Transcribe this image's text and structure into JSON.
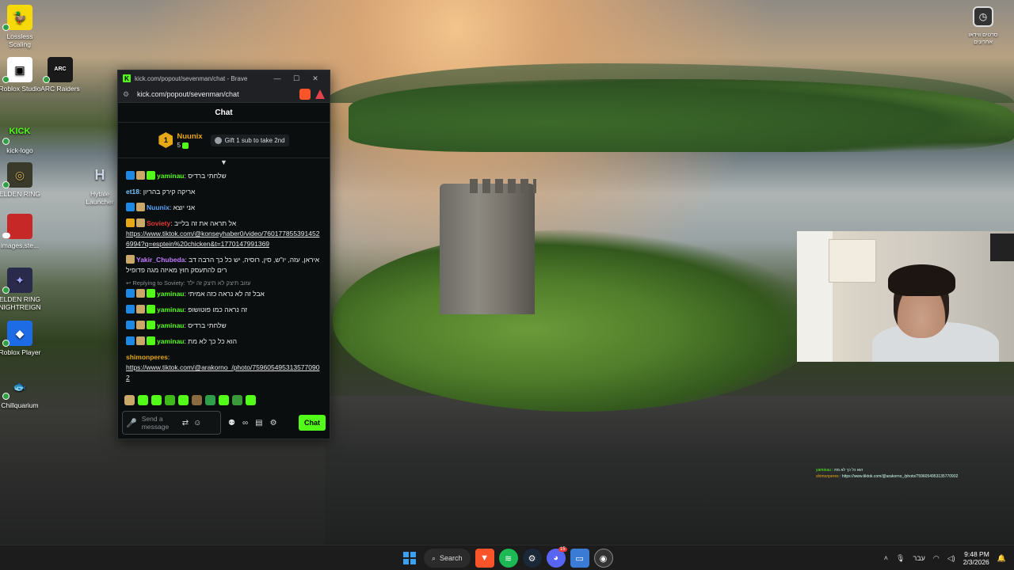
{
  "desktop": {
    "icons": [
      {
        "label": "Lossless Scaling",
        "icon": "duck-icon",
        "color": "#f5d90a",
        "status": "synced"
      },
      {
        "label": "Roblox Studio",
        "icon": "roblox-studio-icon",
        "color": "#ffffff",
        "status": "synced"
      },
      {
        "label": "ARC Raiders",
        "icon": "arc-raiders-icon",
        "color": "#1a1a1a",
        "status": "synced"
      },
      {
        "label": "kick-logo",
        "icon": "kick-logo-icon",
        "color": "#53fc18",
        "status": "synced"
      },
      {
        "label": "ELDEN RING",
        "icon": "elden-ring-icon",
        "color": "#3a3a2a",
        "status": "synced"
      },
      {
        "label": "Hytale Launcher",
        "icon": "hytale-icon",
        "color": "#8fa5c0",
        "status": "none"
      },
      {
        "label": "images.ste...",
        "icon": "image-file-icon",
        "color": "#c62828",
        "status": "cloud"
      },
      {
        "label": "ELDEN RING NIGHTREIGN",
        "icon": "nightreign-icon",
        "color": "#2a2a4a",
        "status": "synced"
      },
      {
        "label": "Roblox Player",
        "icon": "roblox-player-icon",
        "color": "#1e6be6",
        "status": "synced"
      },
      {
        "label": "Chillquarium",
        "icon": "fish-icon",
        "color": "#4a90c0",
        "status": "synced"
      }
    ],
    "top_right": {
      "label": "סרטים ווידאו",
      "sublabel": "אחרונים"
    }
  },
  "browser": {
    "window_title": "kick.com/popout/sevenman/chat - Brave",
    "url": "kick.com/popout/sevenman/chat",
    "rewards_badge": "1"
  },
  "chat": {
    "header": "Chat",
    "pinned": {
      "rank": "1",
      "user": "Nuunix",
      "count": "5",
      "gift_label": "Gift 1 sub to take 2nd"
    },
    "messages": [
      {
        "badges": [
          "verified",
          "sub",
          "green"
        ],
        "user": "yaminau",
        "user_color": "#53fc18",
        "text": "שלחתי ברדיס"
      },
      {
        "badges": [],
        "user": "et18",
        "user_color": "#79c5ff",
        "text": "אריקה קירק בהריון"
      },
      {
        "badges": [
          "verified",
          "sub"
        ],
        "user": "Nuunix",
        "user_color": "#5aa6ff",
        "text": "אני יוצא"
      },
      {
        "badges": [
          "gold",
          "sub"
        ],
        "user": "Soviety",
        "user_color": "#e53935",
        "text": "אל תראה את זה בלייב",
        "link": "https://www.tiktok.com/@konseyhaber0/video/7601778553914526994?q=esptein%20chicken&t=1770147991369"
      },
      {
        "badges": [
          "sub"
        ],
        "user": "Yakir_Chubeda",
        "user_color": "#c27bff",
        "text": "איראן, עזה, יו\"ש, סין, רוסיה, יש כל כך הרבה דברים להתעסק חוץ מאיזה מגה פדופיל"
      },
      {
        "badges": [
          "verified",
          "sub",
          "green"
        ],
        "user": "yaminau",
        "user_color": "#53fc18",
        "text": "אבל זה לא נראה כזה אמיתי",
        "reply_to": "Replying to Soviety:",
        "reply_text": "עזוב תיצק לא תיצק זה ילד"
      },
      {
        "badges": [
          "verified",
          "sub",
          "green"
        ],
        "user": "yaminau",
        "user_color": "#53fc18",
        "text": "זה נראה כמו פוטושופ"
      },
      {
        "badges": [
          "verified",
          "sub",
          "green"
        ],
        "user": "yaminau",
        "user_color": "#53fc18",
        "text": "שלחתי ברדיס"
      },
      {
        "badges": [
          "verified",
          "sub",
          "green"
        ],
        "user": "yaminau",
        "user_color": "#53fc18",
        "text": "הוא כל כך לא מת"
      },
      {
        "badges": [],
        "user": "shimonperes",
        "user_color": "#e6a817",
        "text": "",
        "link": "https://www.tiktok.com/@arakorno_/photo/7596054953135770902"
      }
    ],
    "composer": {
      "placeholder": "Send a message",
      "send_label": "Chat"
    }
  },
  "stream_overlay": {
    "line1_user": "yaminau",
    "line1_text": "הוא כל כך לא מת",
    "line2_user": "shimonperes",
    "line2_text": "https://www.tiktok.com/@arakorno_/photo/7596054953135770902"
  },
  "taskbar": {
    "search_label": "Search",
    "discord_badge": "15",
    "language": "עבר",
    "time": "9:48 PM",
    "date": "2/3/2026"
  }
}
